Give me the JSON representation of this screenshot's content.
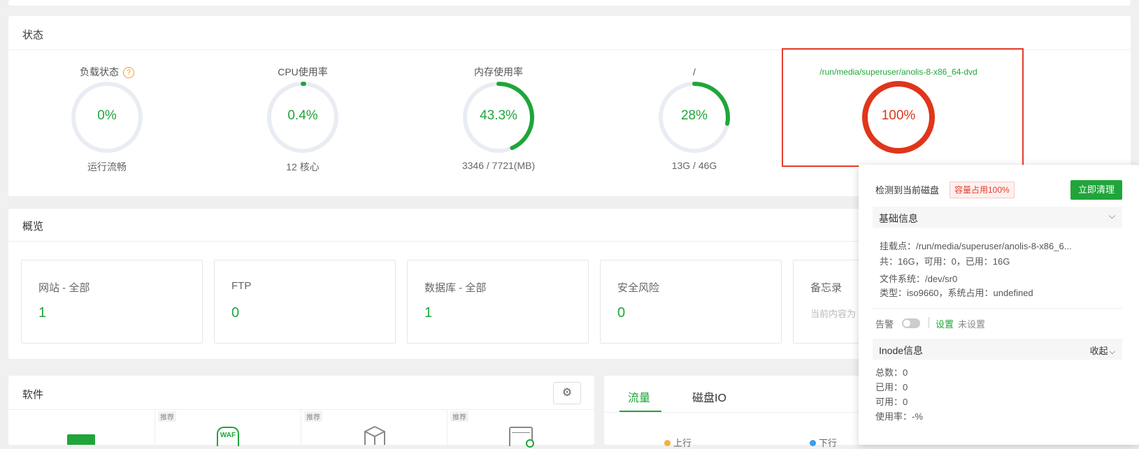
{
  "status": {
    "title": "状态",
    "gauges": [
      {
        "label": "负载状态",
        "value": "0%",
        "sub": "运行流畅",
        "percent": 0,
        "color": "#20a53a"
      },
      {
        "label": "CPU使用率",
        "value": "0.4%",
        "sub": "12 核心",
        "percent": 0.4,
        "color": "#20a53a"
      },
      {
        "label": "内存使用率",
        "value": "43.3%",
        "sub": "3346 / 7721(MB)",
        "percent": 43.3,
        "color": "#20a53a"
      },
      {
        "label": "/",
        "value": "28%",
        "sub": "13G / 46G",
        "percent": 28,
        "color": "#20a53a"
      },
      {
        "label": "/run/media/superuser/anolis-8-x86_64-dvd",
        "value": "100%",
        "sub": "",
        "percent": 100,
        "color": "#e0351b"
      }
    ],
    "help_icon": "question-circle-icon"
  },
  "overview": {
    "title": "概览",
    "tiles": [
      {
        "label": "网站 - 全部",
        "value": "1"
      },
      {
        "label": "FTP",
        "value": "0"
      },
      {
        "label": "数据库 - 全部",
        "value": "1"
      },
      {
        "label": "安全风险",
        "value": "0"
      },
      {
        "label": "备忘录",
        "sub": "当前内容为"
      }
    ]
  },
  "software": {
    "title": "软件",
    "tag": "推荐",
    "settings_icon": "gear-icon",
    "items": [
      "terminal-icon",
      "WAF",
      "box-icon",
      "server-icon"
    ]
  },
  "traffic": {
    "tabs": [
      "流量",
      "磁盘IO"
    ],
    "legend": [
      "上行",
      "下行"
    ]
  },
  "popover": {
    "detected": "检测到当前磁盘",
    "badge": "容量占用100%",
    "clean_button": "立即清理",
    "basic_title": "基础信息",
    "mount": "挂载点：/run/media/superuser/anolis-8-x86_6...",
    "usage": "共：16G，可用：0，已用：16G",
    "fs": "文件系统：/dev/sr0",
    "type": "类型：iso9660，系统占用：undefined",
    "alarm": "告警",
    "settings_link": "设置",
    "unset": "未设置",
    "inode_title": "Inode信息",
    "collapse": "收起",
    "inode_total": "总数：0",
    "inode_used": "已用：0",
    "inode_free": "可用：0",
    "inode_rate": "使用率：-%"
  }
}
